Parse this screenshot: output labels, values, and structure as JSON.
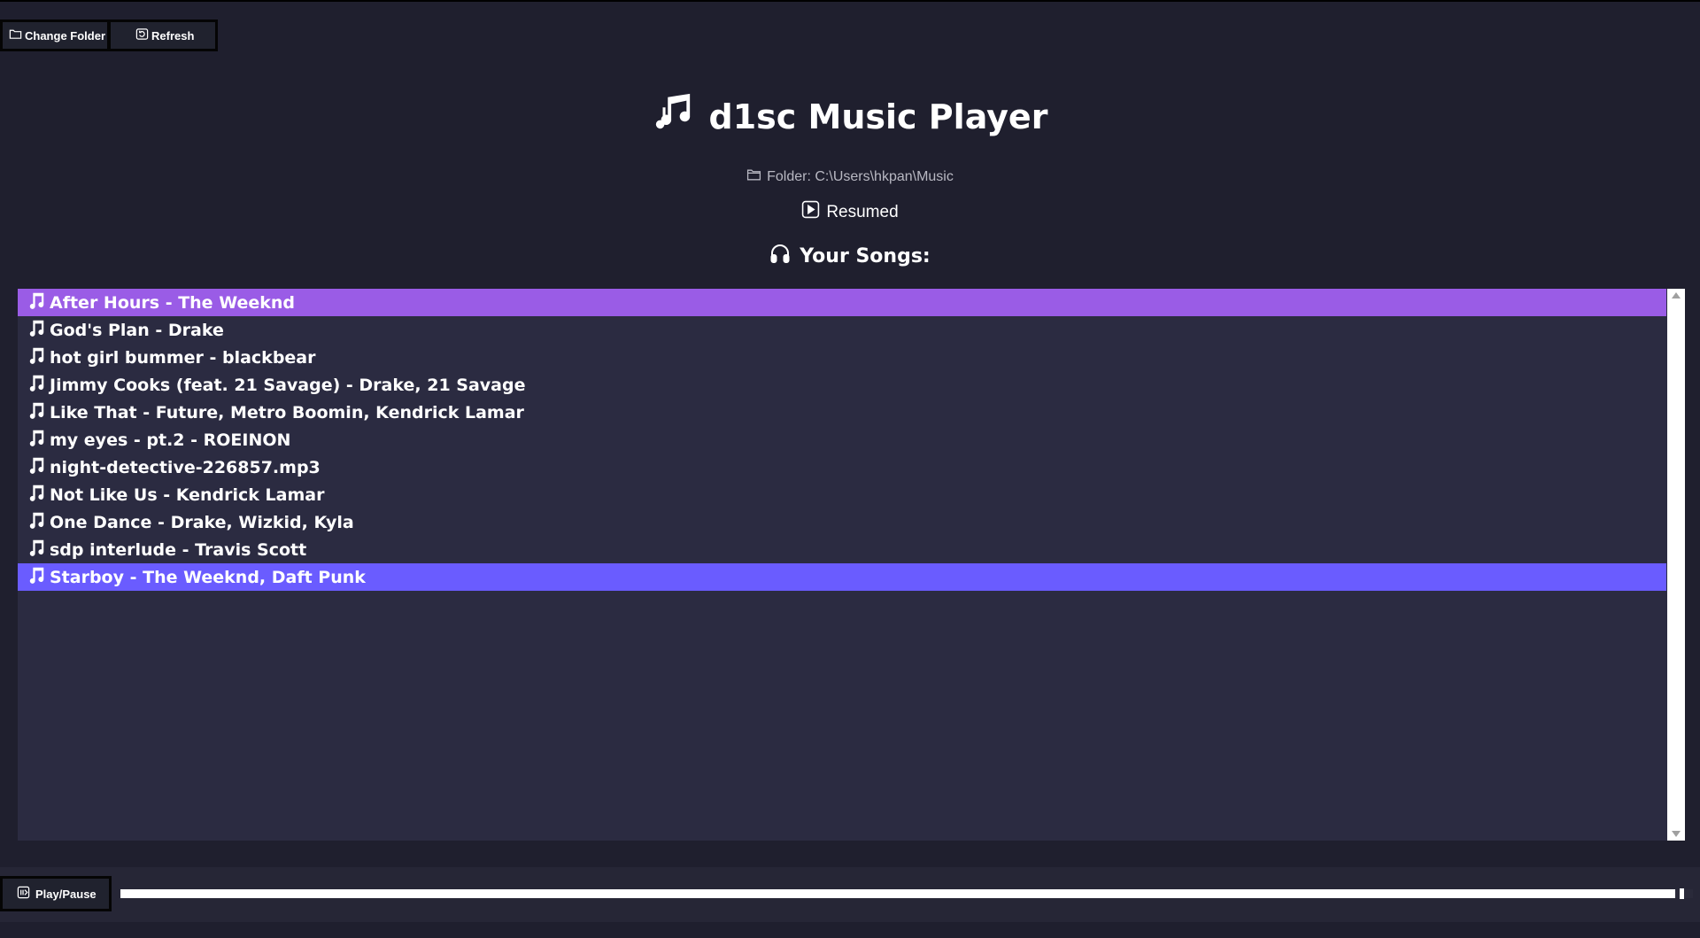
{
  "toolbar": {
    "change_folder_label": "Change Folder",
    "refresh_label": "Refresh"
  },
  "header": {
    "title": "d1sc Music Player",
    "folder_text": "Folder: C:\\Users\\hkpan\\Music",
    "status": "Resumed",
    "songs_heading": "Your Songs:"
  },
  "songs": [
    {
      "title": "After Hours - The Weeknd"
    },
    {
      "title": "God's Plan - Drake"
    },
    {
      "title": "hot girl bummer - blackbear"
    },
    {
      "title": "Jimmy Cooks (feat. 21 Savage) - Drake, 21 Savage"
    },
    {
      "title": "Like That - Future, Metro Boomin, Kendrick Lamar"
    },
    {
      "title": "my eyes - pt.2 - ROEINON"
    },
    {
      "title": "night-detective-226857.mp3"
    },
    {
      "title": "Not Like Us - Kendrick Lamar"
    },
    {
      "title": "One Dance - Drake, Wizkid, Kyla"
    },
    {
      "title": "sdp interlude - Travis Scott"
    },
    {
      "title": "Starboy - The Weeknd, Daft Punk"
    }
  ],
  "current_index": 0,
  "selected_index": 10,
  "player": {
    "play_pause_label": "Play/Pause",
    "progress_fraction": 0.993
  },
  "colors": {
    "background": "#1f1f2e",
    "list_background": "#2b2b41",
    "current_row": "#9a5ce6",
    "selected_row": "#6a5cff"
  }
}
